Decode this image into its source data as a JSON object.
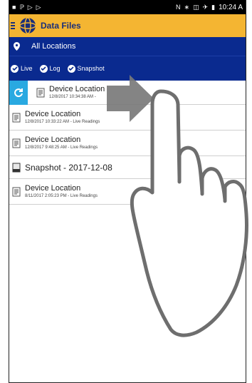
{
  "status_bar": {
    "time": "10:24 A"
  },
  "app_bar": {
    "title": "Data Files"
  },
  "location_bar": {
    "label": "All Locations"
  },
  "filters": [
    {
      "label": "Live",
      "checked": true
    },
    {
      "label": "Log",
      "checked": true
    },
    {
      "label": "Snapshot",
      "checked": true
    }
  ],
  "files": [
    {
      "title": "Device Location",
      "subtitle": "12/8/2017 10:34:38 AM -"
    },
    {
      "title": "Device Location",
      "subtitle": "12/8/2017 10:33:22 AM - Live Readings"
    },
    {
      "title": "Device Location",
      "subtitle": "12/8/2017 9:48:25 AM - Live Readings"
    },
    {
      "title": "Snapshot - 2017-12-08",
      "subtitle": ""
    },
    {
      "title": "Device Location",
      "subtitle": "8/11/2017 2:05:23 PM - Live Readings"
    }
  ],
  "colors": {
    "app_bar": "#f4b532",
    "nav_blue": "#0a2a8f",
    "sync_blue": "#29a9e1",
    "arrow_gray": "#7a7a7a"
  },
  "icons": [
    "notification-icon",
    "wifi-icon",
    "play-icon",
    "nfc-icon",
    "bluetooth-icon",
    "vibrate-icon",
    "airplane-icon",
    "battery-icon",
    "menu-icon",
    "app-logo",
    "location-pin-icon",
    "check-circle-icon",
    "sync-icon",
    "document-icon",
    "swipe-arrow",
    "hand-gesture"
  ]
}
